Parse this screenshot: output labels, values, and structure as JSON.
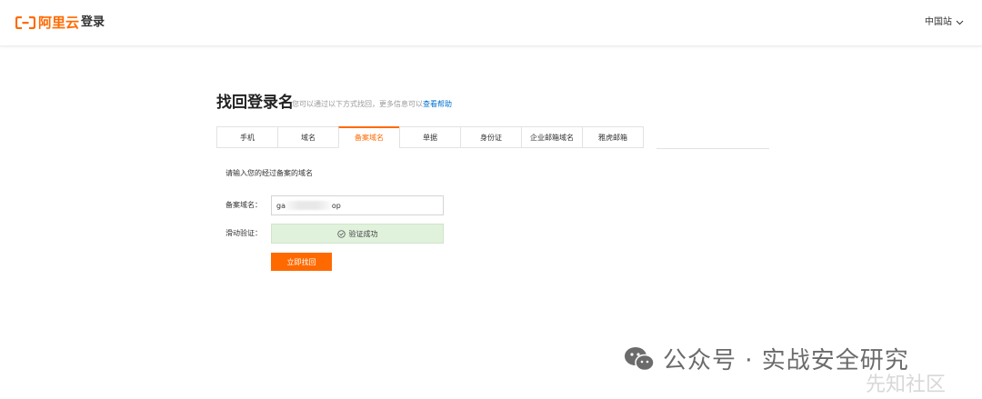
{
  "header": {
    "logo_text": "阿里云",
    "title": "登录",
    "site_selector": "中国站",
    "brand_color": "#ff6a00"
  },
  "main": {
    "title": "找回登录名",
    "subtitle": "您可以通过以下方式找回，更多信息可以",
    "help_link": "查看帮助",
    "tabs": [
      {
        "label": "手机"
      },
      {
        "label": "域名"
      },
      {
        "label": "备案域名"
      },
      {
        "label": "单据"
      },
      {
        "label": "身份证"
      },
      {
        "label": "企业邮箱域名"
      },
      {
        "label": "雅虎邮箱"
      }
    ],
    "active_tab": "备案域名",
    "description": "请输入您的经过备案的域名",
    "domain_label": "备案域名：",
    "domain_value": "ga                    op",
    "slide_label": "滑动验证：",
    "verify_status": "验证成功",
    "submit_label": "立即找回"
  },
  "overlay": {
    "watermark_text": "公众号 · 实战安全研究",
    "watermark2_text": "先知社区"
  },
  "colors": {
    "accent": "#ff6a00",
    "success_bg": "#e0f1dc",
    "link": "#0070cc"
  }
}
